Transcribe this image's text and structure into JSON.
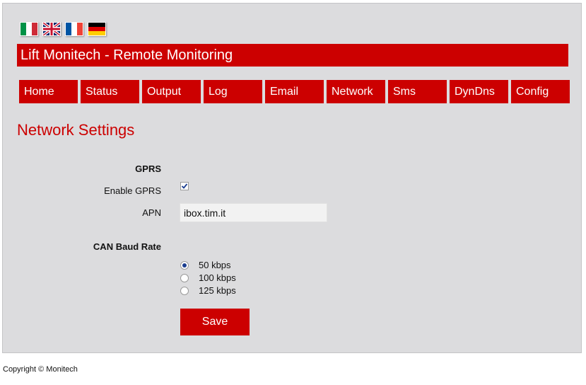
{
  "flags": [
    {
      "name": "italy",
      "colors": [
        "#009246",
        "#ffffff",
        "#ce2b37"
      ],
      "orientation": "vertical"
    },
    {
      "name": "united-kingdom",
      "colors": [
        "#012169",
        "#ffffff",
        "#c8102e"
      ],
      "orientation": "union"
    },
    {
      "name": "france",
      "colors": [
        "#0055a4",
        "#ffffff",
        "#ef4135"
      ],
      "orientation": "vertical"
    },
    {
      "name": "germany",
      "colors": [
        "#000000",
        "#dd0000",
        "#ffce00"
      ],
      "orientation": "horizontal"
    }
  ],
  "header": {
    "title": "Lift Monitech - Remote Monitoring"
  },
  "nav": {
    "items": [
      {
        "label": "Home"
      },
      {
        "label": "Status"
      },
      {
        "label": "Output"
      },
      {
        "label": "Log"
      },
      {
        "label": "Email"
      },
      {
        "label": "Network"
      },
      {
        "label": "Sms"
      },
      {
        "label": "DynDns"
      },
      {
        "label": "Config"
      }
    ]
  },
  "page": {
    "title": "Network Settings"
  },
  "gprs": {
    "section_label": "GPRS",
    "enable_label": "Enable GPRS",
    "enabled": true,
    "apn_label": "APN",
    "apn_value": "ibox.tim.it"
  },
  "can": {
    "section_label": "CAN Baud Rate",
    "options": [
      {
        "label": "50 kbps",
        "selected": true
      },
      {
        "label": "100 kbps",
        "selected": false
      },
      {
        "label": "125 kbps",
        "selected": false
      }
    ]
  },
  "actions": {
    "save_label": "Save"
  },
  "footer": {
    "copyright": "Copyright © Monitech"
  },
  "colors": {
    "accent": "#cc0000",
    "panel": "#dcdcde"
  }
}
